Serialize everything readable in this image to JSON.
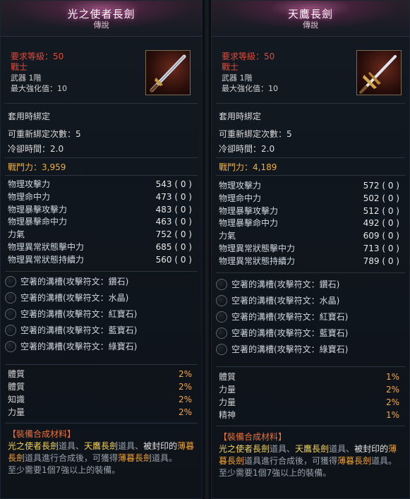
{
  "left": {
    "title": "光之使者長劍",
    "grade": "傳說",
    "req_level": "要求等級：50",
    "class": "戰士",
    "weapon": "武器  1階",
    "max_enhance": "最大強化值：10",
    "bind": "套用時綁定",
    "rebind": "可重新綁定次數：5",
    "cooldown": "冷卻時間：2.0",
    "combat_power": "戰鬥力：3,959",
    "stats": [
      {
        "k": "物理攻擊力",
        "v": "543 ( 0 )"
      },
      {
        "k": "物理命中力",
        "v": "473 ( 0 )"
      },
      {
        "k": "物理暴擊攻擊力",
        "v": "483 ( 0 )"
      },
      {
        "k": "物理暴擊命中力",
        "v": "463 ( 0 )"
      },
      {
        "k": "力氣",
        "v": "752 ( 0 )"
      },
      {
        "k": "物理異常狀態擊中力",
        "v": "685 ( 0 )"
      },
      {
        "k": "物理異常狀態持續力",
        "v": "560 ( 0 )"
      }
    ],
    "slots": [
      "空著的溝槽(攻擊符文：鑽石)",
      "空著的溝槽(攻擊符文：水晶)",
      "空著的溝槽(攻擊符文：紅寶石)",
      "空著的溝槽(攻擊符文：藍寶石)",
      "空著的溝槽(攻擊符文：綠寶石)"
    ],
    "bonus": [
      {
        "k": "體質",
        "v": "2%"
      },
      {
        "k": "體質",
        "v": "2%"
      },
      {
        "k": "知識",
        "v": "2%"
      },
      {
        "k": "力量",
        "v": "2%"
      }
    ]
  },
  "right": {
    "title": "天鷹長劍",
    "grade": "傳說",
    "req_level": "要求等級：50",
    "class": "戰士",
    "weapon": "武器  1階",
    "max_enhance": "最大強化值：10",
    "bind": "套用時綁定",
    "rebind": "可重新綁定次數：5",
    "cooldown": "冷卻時間：2.0",
    "combat_power": "戰鬥力：4,189",
    "stats": [
      {
        "k": "物理攻擊力",
        "v": "572 ( 0 )"
      },
      {
        "k": "物理命中力",
        "v": "502 ( 0 )"
      },
      {
        "k": "物理暴擊攻擊力",
        "v": "512 ( 0 )"
      },
      {
        "k": "物理暴擊命中力",
        "v": "492 ( 0 )"
      },
      {
        "k": "力氣",
        "v": "609 ( 0 )"
      },
      {
        "k": "物理異常狀態擊中力",
        "v": "713 ( 0 )"
      },
      {
        "k": "物理異常狀態持續力",
        "v": "789 ( 0 )"
      }
    ],
    "slots": [
      "空著的溝槽(攻擊符文：鑽石)",
      "空著的溝槽(攻擊符文：水晶)",
      "空著的溝槽(攻擊符文：紅寶石)",
      "空著的溝槽(攻擊符文：藍寶石)",
      "空著的溝槽(攻擊符文：綠寶石)"
    ],
    "bonus": [
      {
        "k": "體質",
        "v": "1%"
      },
      {
        "k": "力量",
        "v": "2%"
      },
      {
        "k": "力量",
        "v": "2%"
      },
      {
        "k": "精神",
        "v": "1%"
      }
    ]
  },
  "material": {
    "head": "【裝備合成材料】",
    "item1": "光之使者長劍",
    "item_suffix": "道具",
    "sep": "、",
    "item2": "天鷹長劍",
    "item3": "被封印的",
    "item3b": "薄暮長劍",
    "mid": "道具進行合成後，可獲得",
    "result": "薄暮長劍",
    "footer": "至少需要1個7強以上的裝備。"
  }
}
